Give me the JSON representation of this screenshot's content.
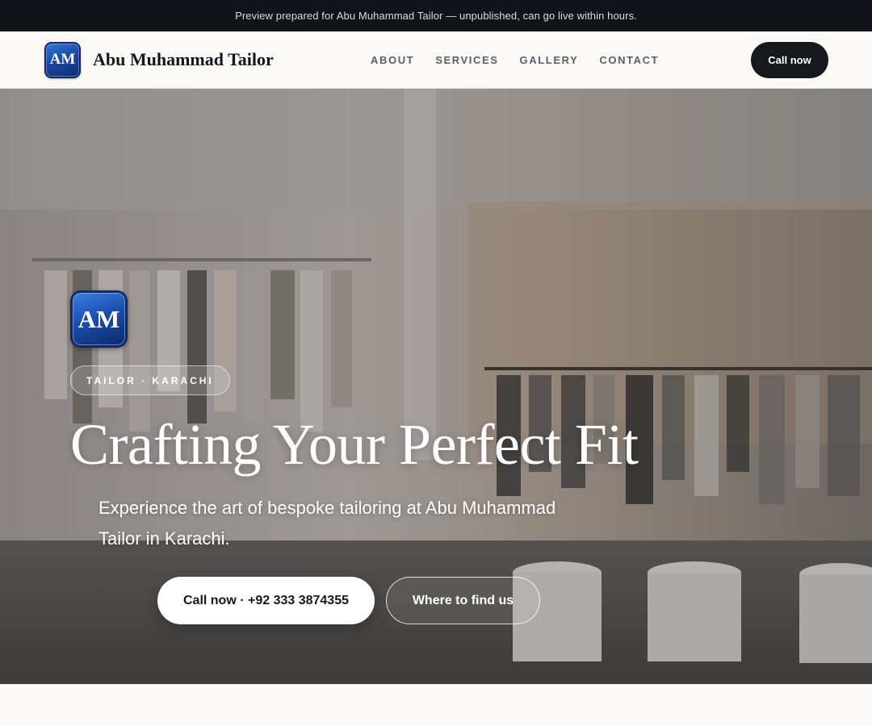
{
  "preview_bar": {
    "text": "Preview prepared for Abu Muhammad Tailor — unpublished, can go live within hours."
  },
  "header": {
    "logo_text": "AM",
    "brand_name": "Abu Muhammad Tailor",
    "nav": [
      {
        "label": "ABOUT"
      },
      {
        "label": "SERVICES"
      },
      {
        "label": "GALLERY"
      },
      {
        "label": "CONTACT"
      }
    ],
    "cta_label": "Call now"
  },
  "hero": {
    "logo_text": "AM",
    "tag": "TAILOR · KARACHI",
    "title": "Crafting Your Perfect Fit",
    "subtitle": "Experience the art of bespoke tailoring at Abu Muhammad Tailor in Karachi.",
    "primary_button": "Call now · +92 333 3874355",
    "secondary_button": "Where to find us",
    "background_image": "clothing-store-interior-photo"
  },
  "colors": {
    "dark": "#16181d",
    "preview_bar_bg": "#11141a",
    "logo_blue": "#1a4aa8",
    "page_bg": "#faf9f6"
  }
}
